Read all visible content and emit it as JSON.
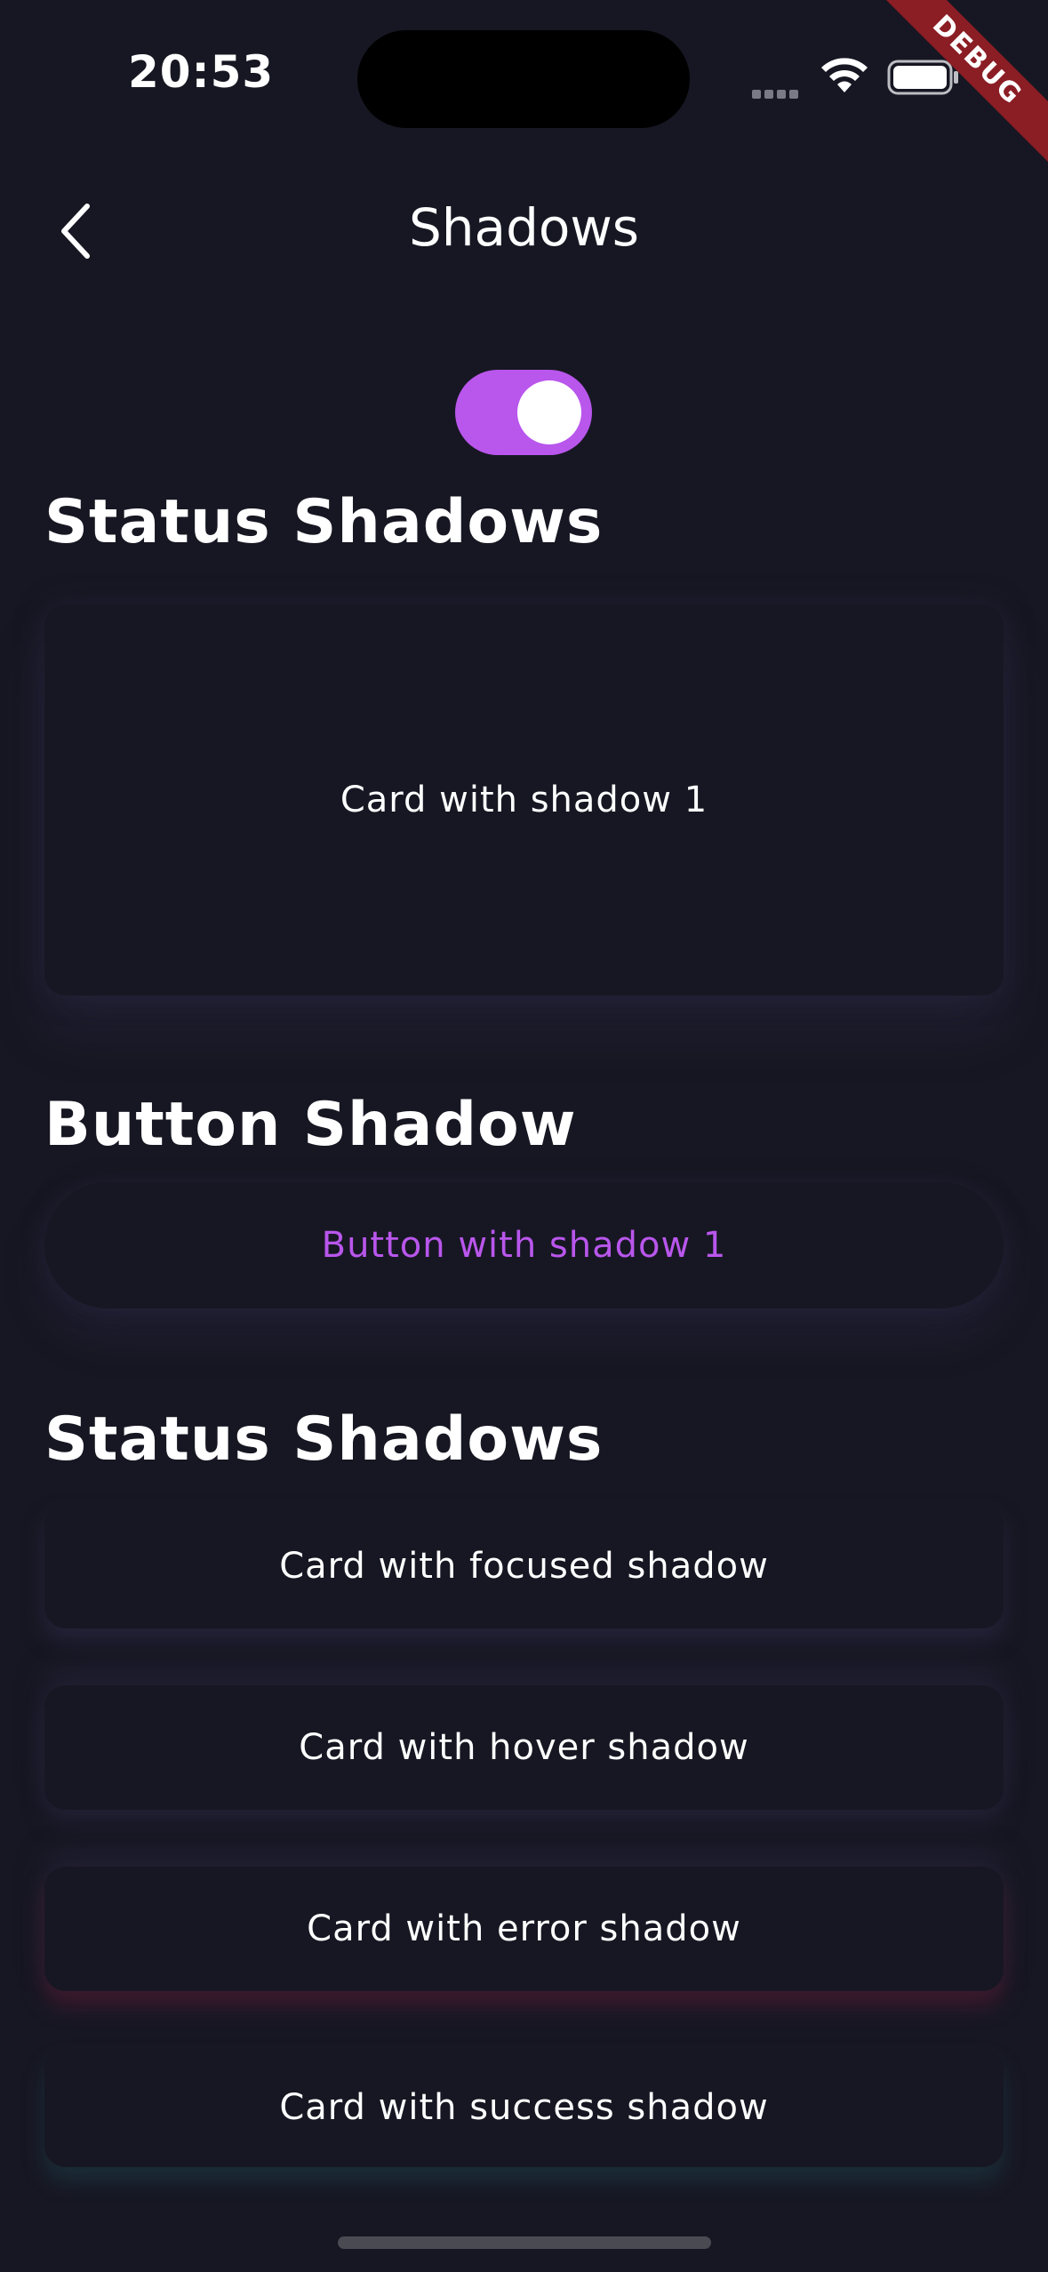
{
  "status_bar": {
    "time": "20:53",
    "icons": [
      "cellular-signal-icon",
      "wifi-icon",
      "battery-icon"
    ]
  },
  "debug_banner": "DEBUG",
  "app_bar": {
    "back_icon": "chevron-left-icon",
    "title": "Shadows"
  },
  "theme_toggle": {
    "state": "on",
    "color": "#b956ec"
  },
  "sections": {
    "status_shadows_1": {
      "title": "Status Shadows",
      "card_label": "Card with shadow 1"
    },
    "button_shadow": {
      "title": "Button Shadow",
      "button_label": "Button with shadow 1"
    },
    "status_shadows_2": {
      "title": "Status Shadows",
      "cards": [
        {
          "label": "Card with focused shadow"
        },
        {
          "label": "Card with hover shadow"
        },
        {
          "label": "Card with error shadow"
        },
        {
          "label": "Card with success shadow"
        }
      ]
    }
  },
  "colors": {
    "background": "#171723",
    "accent": "#b956ec",
    "debug_ribbon": "#8b1d24"
  }
}
